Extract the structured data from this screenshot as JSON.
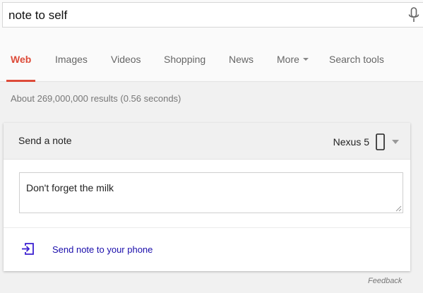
{
  "search": {
    "query": "note to self",
    "mic_icon": "microphone-icon"
  },
  "tabs": [
    {
      "label": "Web",
      "active": true
    },
    {
      "label": "Images",
      "active": false
    },
    {
      "label": "Videos",
      "active": false
    },
    {
      "label": "Shopping",
      "active": false
    },
    {
      "label": "News",
      "active": false
    },
    {
      "label": "More",
      "active": false,
      "has_dropdown": true
    },
    {
      "label": "Search tools",
      "active": false
    }
  ],
  "results_stats": "About 269,000,000 results (0.56 seconds)",
  "note_card": {
    "title": "Send a note",
    "device": {
      "name": "Nexus 5",
      "icon": "phone-icon",
      "dropdown_icon": "triangle-down-icon"
    },
    "note_text": "Don't forget the milk",
    "send_action": {
      "label": "Send note to your phone",
      "icon": "send-to-device-icon"
    }
  },
  "feedback_label": "Feedback",
  "colors": {
    "accent_red": "#dd4b39",
    "link_blue": "#1a0dab",
    "send_icon": "#3b1fd1"
  }
}
